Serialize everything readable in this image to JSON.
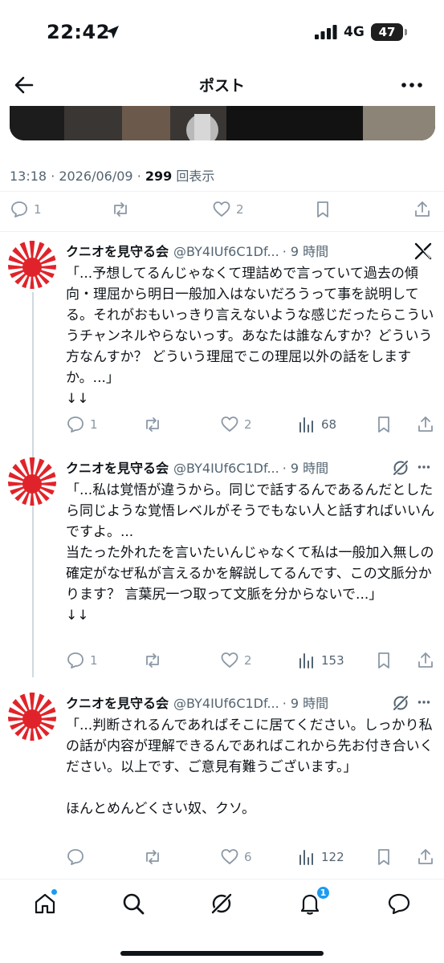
{
  "status_bar": {
    "time": "22:42",
    "network": "4G",
    "battery": "47"
  },
  "header": {
    "title": "ポスト"
  },
  "post": {
    "time": "13:18",
    "date": "2026/06/09",
    "views": "299",
    "views_label": "回表示",
    "replies": "1",
    "likes": "2"
  },
  "replies": [
    {
      "name": "クニオを見守る会",
      "handle": "@BY4IUf6C1Df...",
      "time": "· 9 時間",
      "corner_icon": "x-logo-icon",
      "text": "「...予想してるんじゃなくて理詰めで言っていて過去の傾向・理屈から明日一般加入はないだろうって事を説明してる。それがおもいっきり言えないような感じだったらこういうチャンネルやらないっす。あなたは誰なんすか？どういう方なんすか？ どういう理屈でこの理屈以外の話をしますか。...」\n↓↓",
      "replies": "1",
      "retweets": "",
      "likes": "2",
      "views": "68"
    },
    {
      "name": "クニオを見守る会",
      "handle": "@BY4IUf6C1Df...",
      "time": "· 9 時間",
      "corner_icon": "grok-icon",
      "text": "「...私は覚悟が違うから。同じで話するんであるんだとしたら同じような覚悟レベルがそうでもない人と話すればいいんですよ。...\n当たった外れたを言いたいんじゃなくて私は一般加入無しの確定がなぜ私が言えるかを解説してるんです、この文脈分かります？ 言葉尻一つ取って文脈を分からないで...」\n↓↓",
      "replies": "1",
      "retweets": "",
      "likes": "2",
      "views": "153"
    },
    {
      "name": "クニオを見守る会",
      "handle": "@BY4IUf6C1Df...",
      "time": "· 9 時間",
      "corner_icon": "grok-icon",
      "text": "「...判断されるんであればそこに居てください。しっかり私の話が内容が理解できるんであればこれから先お付き合いください。以上です、ご意見有難うございます。」\n\nほんとめんどくさい奴、クソ。",
      "replies": "",
      "retweets": "",
      "likes": "6",
      "views": "122"
    }
  ],
  "bottom_nav": {
    "notifications_badge": "1"
  },
  "colors": {
    "accent": "#1d9bf0",
    "flag_red": "#e0232a",
    "muted": "#8b98a5"
  }
}
